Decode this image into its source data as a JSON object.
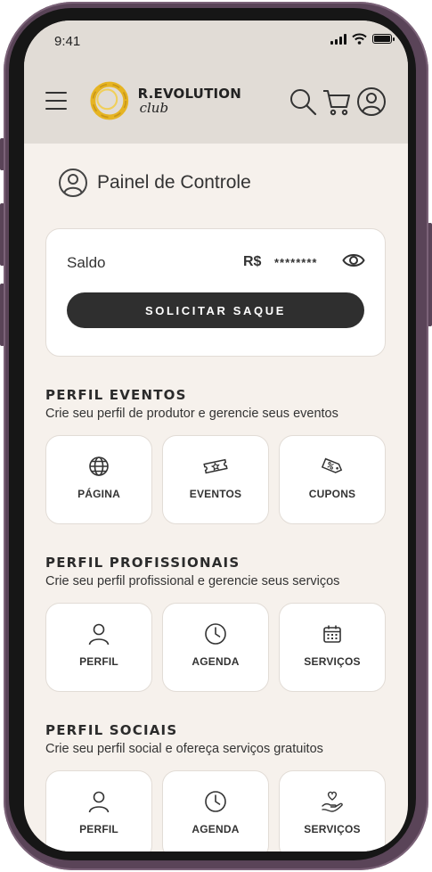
{
  "status_bar": {
    "time": "9:41"
  },
  "header": {
    "brand_title": "R.EVOLUTION",
    "brand_sub": "club",
    "icons": [
      "menu-icon",
      "search-icon",
      "cart-icon",
      "user-icon"
    ]
  },
  "panel": {
    "title": "Painel de Controle"
  },
  "balance": {
    "label": "Saldo",
    "currency": "R$",
    "masked_value": "********",
    "withdraw_button": "SOLICITAR SAQUE"
  },
  "sections": [
    {
      "title": "PERFIL EVENTOS",
      "description": "Crie seu perfil de produtor e gerencie seus eventos",
      "tiles": [
        {
          "label": "PÁGINA",
          "icon": "globe-icon"
        },
        {
          "label": "EVENTOS",
          "icon": "ticket-icon"
        },
        {
          "label": "CUPONS",
          "icon": "coupon-icon"
        }
      ]
    },
    {
      "title": "PERFIL PROFISSIONAIS",
      "description": "Crie seu perfil profissional e gerencie seus serviços",
      "tiles": [
        {
          "label": "PERFIL",
          "icon": "user-icon"
        },
        {
          "label": "AGENDA",
          "icon": "clock-icon"
        },
        {
          "label": "SERVIÇOS",
          "icon": "calendar-icon"
        }
      ]
    },
    {
      "title": "PERFIL SOCIAIS",
      "description": "Crie seu perfil social e ofereça serviços gratuitos",
      "tiles": [
        {
          "label": "PERFIL",
          "icon": "user-icon"
        },
        {
          "label": "AGENDA",
          "icon": "clock-icon"
        },
        {
          "label": "SERVIÇOS",
          "icon": "heart-hand-icon"
        }
      ]
    }
  ],
  "colors": {
    "header_bg": "#e1dcd6",
    "screen_bg": "#f6f1ec",
    "button_bg": "#2f2f2f",
    "frame": "#5a4458",
    "logo_gold": "#e6b422"
  }
}
